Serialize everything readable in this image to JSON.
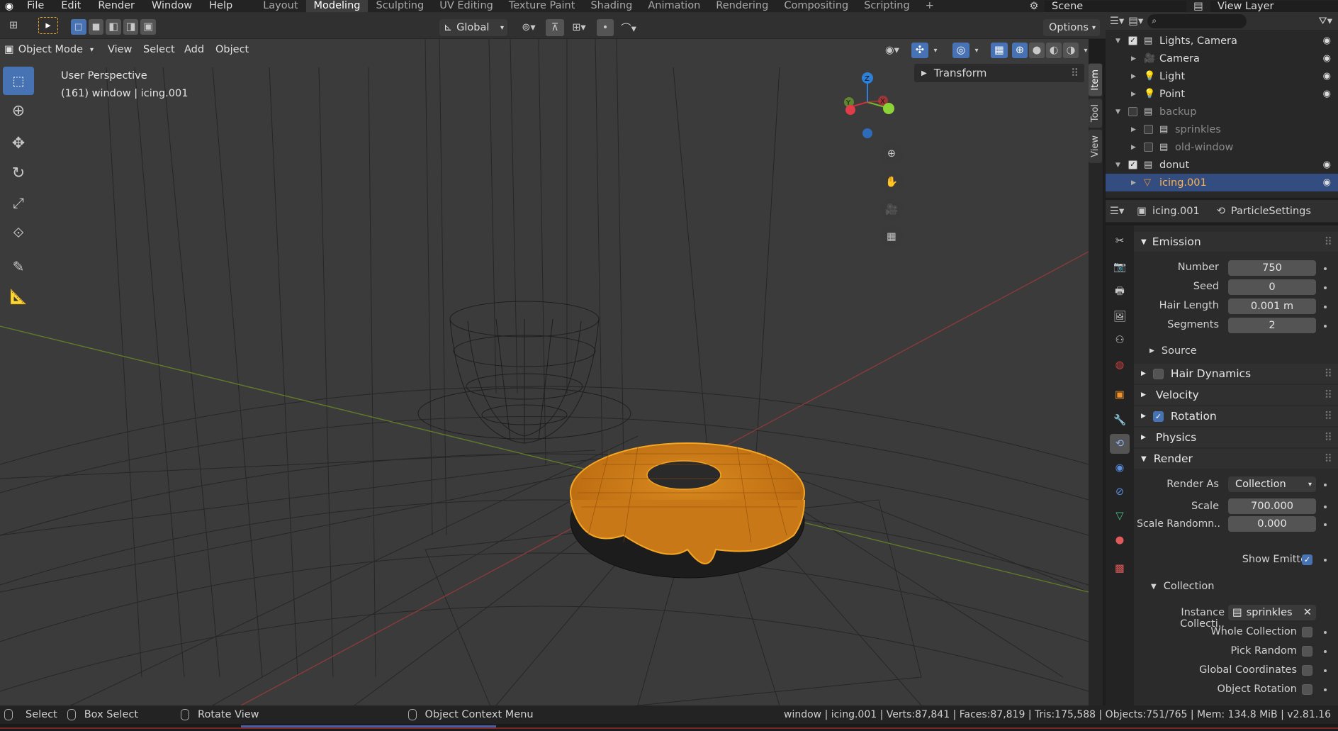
{
  "app": {
    "name": "Blender",
    "version": "v2.81.16"
  },
  "menu": [
    "File",
    "Edit",
    "Render",
    "Window",
    "Help"
  ],
  "workspaces": [
    {
      "label": "Layout",
      "active": false
    },
    {
      "label": "Modeling",
      "active": true
    },
    {
      "label": "Sculpting",
      "active": false
    },
    {
      "label": "UV Editing",
      "active": false
    },
    {
      "label": "Texture Paint",
      "active": false
    },
    {
      "label": "Shading",
      "active": false
    },
    {
      "label": "Animation",
      "active": false
    },
    {
      "label": "Rendering",
      "active": false
    },
    {
      "label": "Compositing",
      "active": false
    },
    {
      "label": "Scripting",
      "active": false
    }
  ],
  "scene": {
    "label": "Scene"
  },
  "view_layer": {
    "label": "View Layer"
  },
  "toolbar": {
    "transform_orientation": "Global",
    "options_label": "Options"
  },
  "viewport": {
    "mode": "Object Mode",
    "menus": [
      "View",
      "Select",
      "Add",
      "Object"
    ],
    "perspective_label": "User Perspective",
    "object_info": "(161) window | icing.001",
    "transform_panel": "Transform",
    "side_tabs": [
      "Item",
      "Tool",
      "View"
    ],
    "gizmo": {
      "z": "Z",
      "y": "Y",
      "x": "X"
    }
  },
  "outliner": {
    "search_placeholder": "",
    "rows": [
      {
        "label": "Lights, Camera",
        "indent": 1,
        "icon": "collection-icon",
        "checked": true,
        "dim": false,
        "visible": true
      },
      {
        "label": "Camera",
        "indent": 2,
        "icon": "camera-icon",
        "checked": null,
        "dim": false,
        "visible": true
      },
      {
        "label": "Light",
        "indent": 2,
        "icon": "light-icon",
        "checked": null,
        "dim": false,
        "visible": true
      },
      {
        "label": "Point",
        "indent": 2,
        "icon": "light-icon",
        "checked": null,
        "dim": false,
        "visible": true
      },
      {
        "label": "backup",
        "indent": 1,
        "icon": "collection-icon",
        "checked": false,
        "dim": true,
        "visible": false
      },
      {
        "label": "sprinkles",
        "indent": 2,
        "icon": "collection-icon",
        "checked": false,
        "dim": true,
        "visible": false
      },
      {
        "label": "old-window",
        "indent": 2,
        "icon": "collection-icon",
        "checked": false,
        "dim": true,
        "visible": false
      },
      {
        "label": "donut",
        "indent": 1,
        "icon": "collection-icon",
        "checked": true,
        "dim": false,
        "visible": true
      },
      {
        "label": "icing.001",
        "indent": 2,
        "icon": "mesh-icon",
        "checked": null,
        "dim": false,
        "visible": true,
        "selected": true
      }
    ]
  },
  "properties": {
    "object_name": "icing.001",
    "particle_settings": "ParticleSettings",
    "emission": {
      "header": "Emission",
      "number_label": "Number",
      "number": "750",
      "seed_label": "Seed",
      "seed": "0",
      "hair_length_label": "Hair Length",
      "hair_length": "0.001 m",
      "segments_label": "Segments",
      "segments": "2",
      "source_label": "Source"
    },
    "hair_dynamics": "Hair Dynamics",
    "velocity": "Velocity",
    "rotation": "Rotation",
    "physics": "Physics",
    "render": {
      "header": "Render",
      "render_as_label": "Render As",
      "render_as": "Collection",
      "scale_label": "Scale",
      "scale": "700.000",
      "scale_random_label": "Scale Randomn..",
      "scale_random": "0.000",
      "show_emitter_label": "Show Emitter"
    },
    "collection": {
      "header": "Collection",
      "instance_label": "Instance Collecti..",
      "instance": "sprinkles",
      "whole_collection": "Whole Collection",
      "pick_random": "Pick Random",
      "global_coordinates": "Global Coordinates",
      "object_rotation": "Object Rotation"
    }
  },
  "status": {
    "select": "Select",
    "box_select": "Box Select",
    "rotate_view": "Rotate View",
    "context_menu": "Object Context Menu",
    "info": "window | icing.001 | Verts:87,841 | Faces:87,819 | Tris:175,588 | Objects:751/765 | Mem: 134.8 MiB | v2.81.16"
  },
  "colors": {
    "accent": "#4772b3",
    "selection": "#f5a623",
    "bg": "#3b3b3b",
    "panel": "#2b2b2b"
  }
}
